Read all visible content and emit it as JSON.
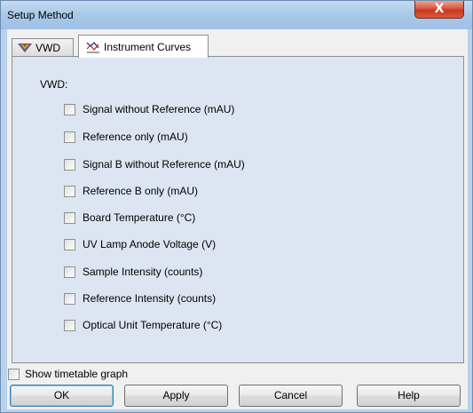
{
  "window": {
    "title": "Setup Method",
    "close_label": "X"
  },
  "tabs": [
    {
      "label": "VWD",
      "icon": "vwd-prism-icon",
      "active": false
    },
    {
      "label": "Instrument Curves",
      "icon": "instrument-curves-icon",
      "active": true
    }
  ],
  "panel": {
    "section_label": "VWD:",
    "checkboxes": [
      {
        "label": "Signal without Reference (mAU)",
        "checked": false
      },
      {
        "label": "Reference only (mAU)",
        "checked": false
      },
      {
        "label": "Signal B without Reference (mAU)",
        "checked": false
      },
      {
        "label": "Reference B only (mAU)",
        "checked": false
      },
      {
        "label": "Board Temperature (°C)",
        "checked": false
      },
      {
        "label": "UV Lamp Anode Voltage (V)",
        "checked": false
      },
      {
        "label": "Sample Intensity (counts)",
        "checked": false
      },
      {
        "label": "Reference Intensity (counts)",
        "checked": false
      },
      {
        "label": "Optical Unit Temperature (°C)",
        "checked": false
      }
    ]
  },
  "footer": {
    "show_timetable_label": "Show timetable graph",
    "show_timetable_checked": false,
    "buttons": {
      "ok": "OK",
      "apply": "Apply",
      "cancel": "Cancel",
      "help": "Help"
    }
  }
}
